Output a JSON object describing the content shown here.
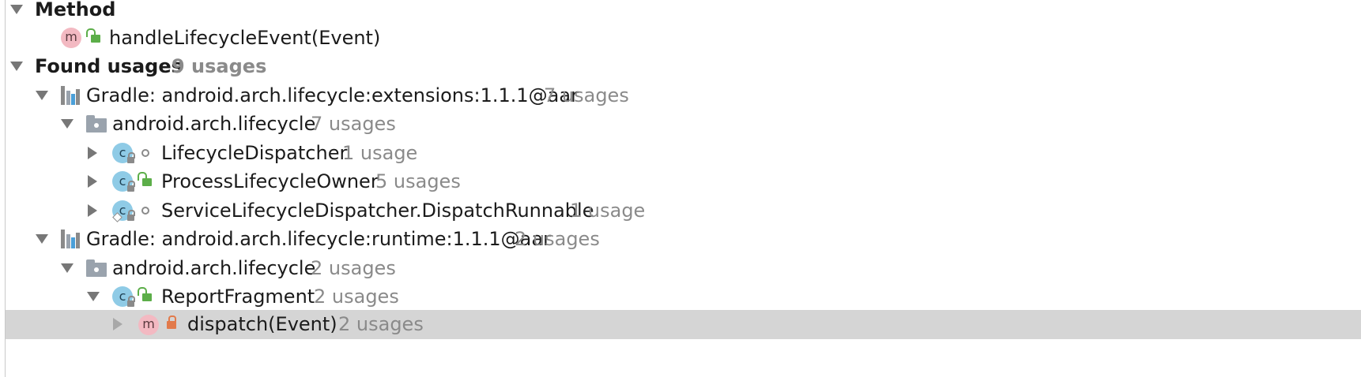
{
  "tree": {
    "method_header": {
      "label": "Method"
    },
    "target_method": {
      "label": "handleLifecycleEvent(Event)",
      "badge": "m"
    },
    "found_usages": {
      "label": "Found usages",
      "count": "9 usages"
    },
    "groups": [
      {
        "label": "Gradle: android.arch.lifecycle:extensions:1.1.1@aar",
        "count": "7 usages",
        "package": {
          "label": "android.arch.lifecycle",
          "count": "7 usages"
        },
        "classes": [
          {
            "label": "LifecycleDispatcher",
            "count": "1 usage",
            "badge": "c",
            "visibility": "package"
          },
          {
            "label": "ProcessLifecycleOwner",
            "count": "5 usages",
            "badge": "c",
            "visibility": "public"
          },
          {
            "label": "ServiceLifecycleDispatcher.DispatchRunnable",
            "count": "1 usage",
            "badge": "c",
            "visibility": "package"
          }
        ]
      },
      {
        "label": "Gradle: android.arch.lifecycle:runtime:1.1.1@aar",
        "count": "2 usages",
        "package": {
          "label": "android.arch.lifecycle",
          "count": "2 usages"
        },
        "classes": [
          {
            "label": "ReportFragment",
            "count": "2 usages",
            "badge": "c",
            "visibility": "public"
          }
        ],
        "method": {
          "label": "dispatch(Event)",
          "count": "2 usages",
          "badge": "m",
          "visibility": "private",
          "selected": true
        }
      }
    ]
  },
  "colors": {
    "selection": "#d5d5d5",
    "method_badge": "#f3b9c2",
    "class_badge": "#8fcbe6",
    "public_lock": "#5cae49",
    "private_lock": "#e27a4b"
  }
}
